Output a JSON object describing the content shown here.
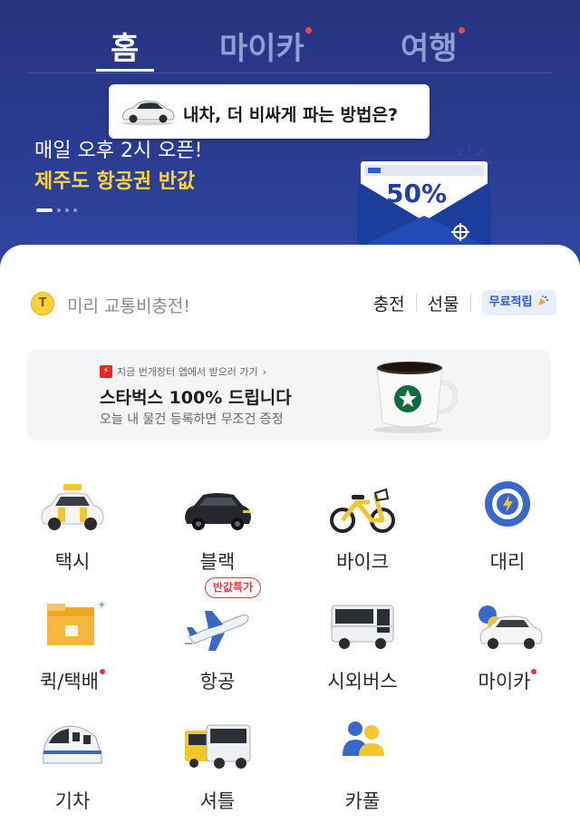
{
  "tabs": [
    {
      "label": "홈",
      "active": true,
      "has_dot": false
    },
    {
      "label": "마이카",
      "active": false,
      "has_dot": true
    },
    {
      "label": "여행",
      "active": false,
      "has_dot": true
    }
  ],
  "promo_bubble": {
    "text": "내차, 더 비싸게 파는 방법은?",
    "icon": "car-icon"
  },
  "banner": {
    "line1": "매일 오후 2시 오픈!",
    "line2": "제주도 항공권 반값",
    "envelope_badge": "50%",
    "pager": {
      "count": 4,
      "active_index": 0
    }
  },
  "charge": {
    "text": "미리 교통비충전!",
    "coin_symbol": "T",
    "links": [
      "충전",
      "선물"
    ],
    "free_badge": "무료적립"
  },
  "ad": {
    "source": "지금 번개장터 앱에서 받으러 가기",
    "title": "스타벅스 100% 드립니다",
    "subtitle": "오늘 내 물건 등록하면 무조건 증정"
  },
  "services": [
    {
      "label": "택시",
      "icon": "taxi-icon",
      "has_dot": false
    },
    {
      "label": "블랙",
      "icon": "black-car-icon",
      "has_dot": false
    },
    {
      "label": "바이크",
      "icon": "bike-icon",
      "has_dot": false
    },
    {
      "label": "대리",
      "icon": "steering-wheel-icon",
      "has_dot": false
    },
    {
      "label": "퀵/택배",
      "icon": "parcel-box-icon",
      "has_dot": true
    },
    {
      "label": "항공",
      "icon": "airplane-icon",
      "has_dot": false,
      "tag": "반값특가"
    },
    {
      "label": "시외버스",
      "icon": "bus-icon",
      "has_dot": false
    },
    {
      "label": "마이카",
      "icon": "my-car-icon",
      "has_dot": true
    },
    {
      "label": "기차",
      "icon": "train-icon",
      "has_dot": false
    },
    {
      "label": "셔틀",
      "icon": "shuttle-icon",
      "has_dot": false
    },
    {
      "label": "카풀",
      "icon": "carpool-icon",
      "has_dot": false
    }
  ],
  "colors": {
    "header_bg": "#2a3c91",
    "accent_yellow": "#ffd43b",
    "notice_dot": "#e8323a",
    "badge_blue": "#2f58d8"
  }
}
